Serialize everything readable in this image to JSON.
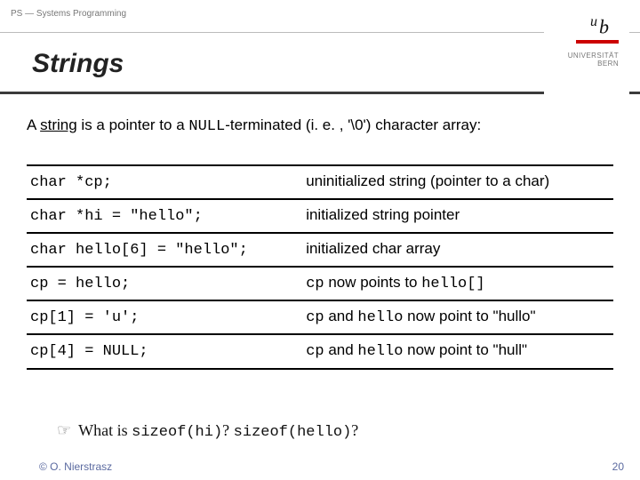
{
  "header": {
    "course": "PS — Systems Programming",
    "title": "Strings",
    "uni_line1": "UNIVERSITÄT",
    "uni_line2": "BERN"
  },
  "intro": {
    "prefix": "A ",
    "keyword": "string",
    "mid1": " is a pointer to a ",
    "code": "NULL",
    "mid2": "-terminated (i. e. , '\\0') character array:"
  },
  "rows": [
    {
      "code": "char *cp;",
      "desc_pre": "",
      "desc_code1": "",
      "desc_mid": "uninitialized string (pointer to a char)",
      "desc_code2": "",
      "desc_post": ""
    },
    {
      "code": "char *hi = \"hello\";",
      "desc_pre": "",
      "desc_code1": "",
      "desc_mid": "initialized string pointer",
      "desc_code2": "",
      "desc_post": ""
    },
    {
      "code": "char hello[6] = \"hello\";",
      "desc_pre": "",
      "desc_code1": "",
      "desc_mid": "initialized char array",
      "desc_code2": "",
      "desc_post": ""
    },
    {
      "code": "cp = hello;",
      "desc_pre": "",
      "desc_code1": "cp",
      "desc_mid": " now points to ",
      "desc_code2": "hello[]",
      "desc_post": ""
    },
    {
      "code": "cp[1] = 'u';",
      "desc_pre": "",
      "desc_code1": "cp",
      "desc_mid": " and ",
      "desc_code2": "hello",
      "desc_post": " now point to \"hullo\""
    },
    {
      "code": "cp[4] = NULL;",
      "desc_pre": "",
      "desc_code1": "cp",
      "desc_mid": " and ",
      "desc_code2": "hello",
      "desc_post": " now point to \"hull\""
    }
  ],
  "note": {
    "icon": "☞",
    "pre": "What is ",
    "code1": "sizeof(hi)",
    "mid": "? ",
    "code2": "sizeof(hello)",
    "post": "?"
  },
  "footer": {
    "copyright": "© O. Nierstrasz",
    "page": "20"
  }
}
